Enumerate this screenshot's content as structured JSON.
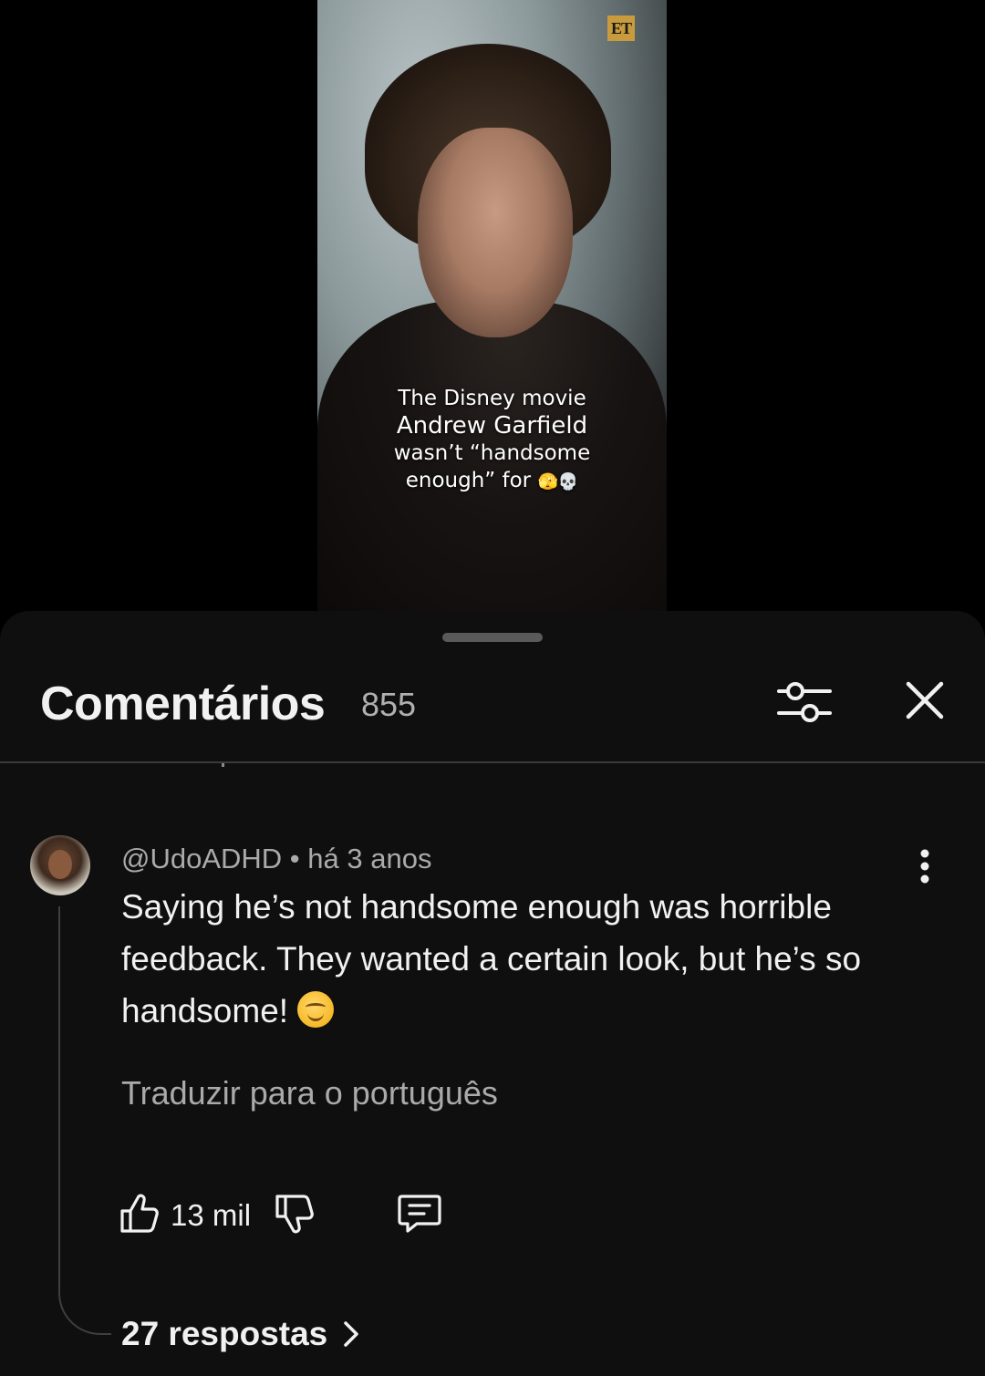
{
  "video": {
    "brand_badge": "ET",
    "caption_lines": [
      "The Disney movie",
      "Andrew Garfield",
      "wasn’t “handsome",
      "enough” for"
    ],
    "caption_emojis": "🫣💀"
  },
  "comments_panel": {
    "title": "Comentários",
    "count": "855",
    "icons": {
      "filter": "sort-filter-icon",
      "close": "close-icon"
    }
  },
  "comment": {
    "author": "@UdoADHD",
    "separator": " • ",
    "time": "há 3 anos",
    "text": "Saying he’s not handsome enough was horrible feedback. They wanted a certain look, but he’s so handsome!",
    "emoji": "smiling-face-icon",
    "translate_label": "Traduzir para o português",
    "likes": "13 mil",
    "replies_label": "27 respostas",
    "icons": {
      "like": "thumbs-up-icon",
      "dislike": "thumbs-down-icon",
      "reply": "reply-comment-icon",
      "more": "more-vertical-icon",
      "chevron": "chevron-right-icon"
    }
  }
}
